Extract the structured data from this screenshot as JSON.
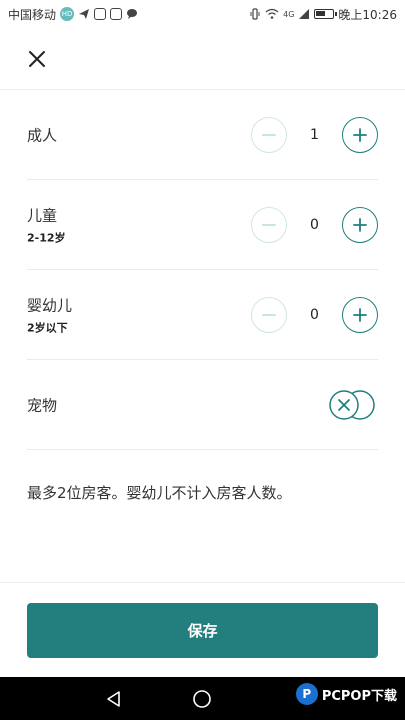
{
  "status_bar": {
    "carrier": "中国移动",
    "time": "晚上10:26",
    "network": "4G",
    "icons": [
      "hd-icon",
      "telegram-icon",
      "app-icon",
      "app-icon-2",
      "chat-icon",
      "vibrate-icon",
      "wifi-icon",
      "signal-icon",
      "battery-icon"
    ]
  },
  "header": {
    "close_icon": "close-icon"
  },
  "rows": [
    {
      "label": "成人",
      "sub": "",
      "value": "1"
    },
    {
      "label": "儿童",
      "sub": "2-12岁",
      "value": "0"
    },
    {
      "label": "婴幼儿",
      "sub": "2岁以下",
      "value": "0"
    }
  ],
  "pet": {
    "label": "宠物",
    "enabled": false
  },
  "note": "最多2位房客。婴幼儿不计入房客人数。",
  "save_label": "保存",
  "watermark": {
    "text": "PCPOP下载",
    "logo": "P"
  },
  "colors": {
    "accent": "#237f7e",
    "accent_light": "#cfe6e4"
  }
}
